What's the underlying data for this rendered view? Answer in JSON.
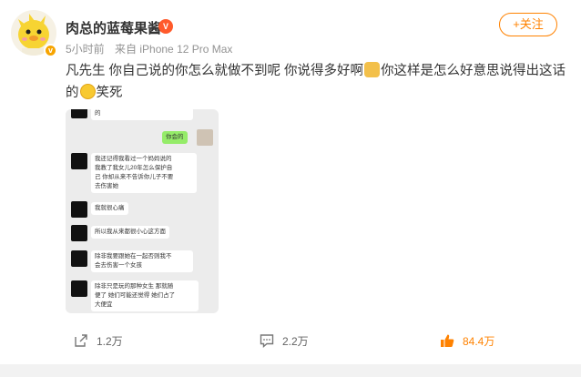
{
  "post": {
    "username": "肉总的蓝莓果酱",
    "vip_badge": "V",
    "verified_mark": "v",
    "meta": {
      "time": "5小时前",
      "source": "来自 iPhone 12 Pro Max"
    },
    "follow_label": "+关注",
    "text_part1": "凡先生 你自己说的你怎么就做不到呢 你说得多好啊",
    "text_part2": "你这样是怎么好意思说得出这话的",
    "text_part3": "笑死"
  },
  "chat": {
    "top_fragment": "的",
    "reply_green": "你会的",
    "messages": [
      "我还记得我看过一个妈妈说的\n我教了我女儿20年怎么保护自\n己 你却从来不告诉你儿子不要\n去伤害她",
      "我就很心痛",
      "所以我从来都很小心这方面",
      "除非我要跟她在一起否则我不\n会去伤害一个女孩",
      "除非只是玩的那种女生 那就随\n便了 她们可能还觉得 她们占了\n大便宜"
    ]
  },
  "actions": {
    "repost_count": "1.2万",
    "comment_count": "2.2万",
    "like_count": "84.4万"
  },
  "colors": {
    "accent": "#ff8200",
    "meta_gray": "#939393"
  }
}
